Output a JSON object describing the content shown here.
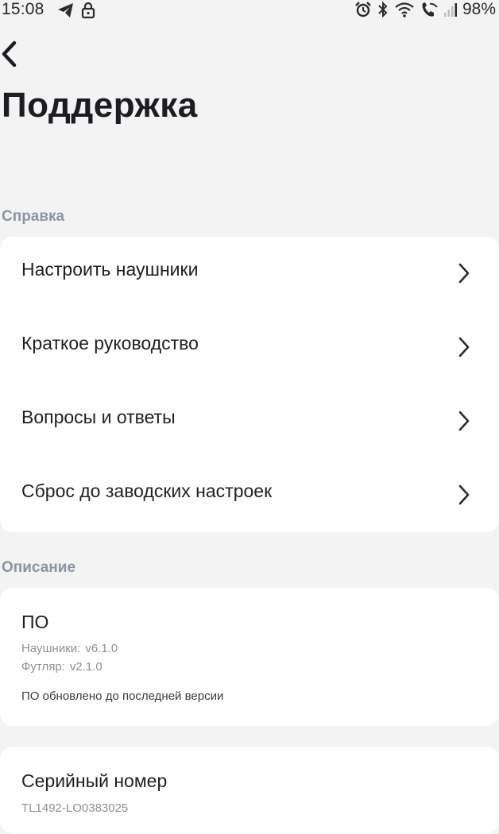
{
  "status_bar": {
    "time": "15:08",
    "battery": "98%"
  },
  "header": {
    "title": "Поддержка"
  },
  "sections": {
    "help": {
      "label": "Справка",
      "items": [
        {
          "label": "Настроить наушники"
        },
        {
          "label": "Краткое руководство"
        },
        {
          "label": "Вопросы и ответы"
        },
        {
          "label": "Сброс до заводских настроек"
        }
      ]
    },
    "description": {
      "label": "Описание",
      "firmware": {
        "title": "ПО",
        "earbuds_label": "Наушники:",
        "earbuds_version": "v6.1.0",
        "case_label": "Футляр:",
        "case_version": "v2.1.0",
        "status": "ПО обновлено до последней версии"
      },
      "serial": {
        "title": "Серийный номер",
        "value": "TL1492-LO0383025"
      }
    }
  }
}
